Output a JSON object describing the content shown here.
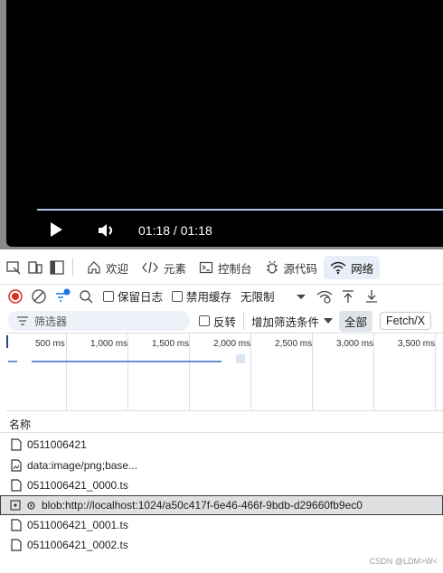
{
  "player": {
    "time": "01:18 / 01:18"
  },
  "tabs": {
    "welcome": "欢迎",
    "elements": "元素",
    "console": "控制台",
    "sources": "源代码",
    "network": "网络"
  },
  "toolbar": {
    "preserve_log": "保留日志",
    "disable_cache": "禁用缓存",
    "throttle": "无限制"
  },
  "filter": {
    "placeholder": "筛选器",
    "invert": "反转",
    "more_filters": "增加筛选条件",
    "all": "全部",
    "fetch": "Fetch/X"
  },
  "timeline": {
    "ticks": [
      "500 ms",
      "1,000 ms",
      "1,500 ms",
      "2,000 ms",
      "2,500 ms",
      "3,000 ms",
      "3,500 ms"
    ]
  },
  "requests": {
    "header": "名称",
    "rows": [
      {
        "name": "0511006421"
      },
      {
        "name": "data:image/png;base..."
      },
      {
        "name": "0511006421_0000.ts"
      },
      {
        "name": "blob:http://localhost:1024/a50c417f-6e46-466f-9bdb-d29660fb9ec0"
      },
      {
        "name": "0511006421_0001.ts"
      },
      {
        "name": "0511006421_0002.ts"
      }
    ]
  },
  "watermark": "CSDN @LDM>W<"
}
